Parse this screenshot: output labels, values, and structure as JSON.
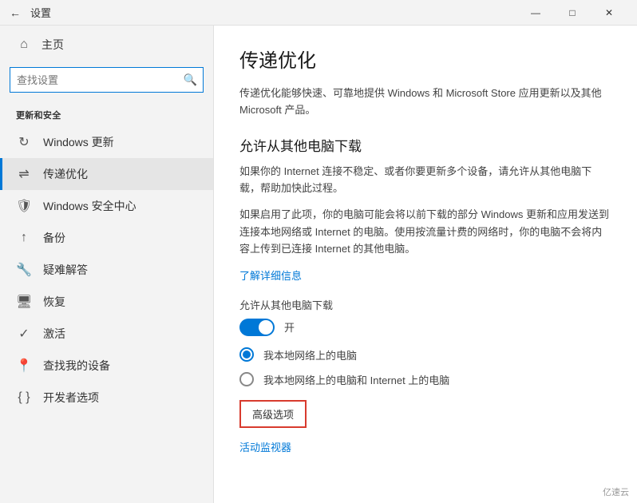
{
  "titlebar": {
    "back_icon": "←",
    "title": "设置",
    "minimize": "—",
    "maximize": "□",
    "close": "✕"
  },
  "sidebar": {
    "home_label": "主页",
    "search_placeholder": "查找设置",
    "section_title": "更新和安全",
    "items": [
      {
        "id": "windows-update",
        "label": "Windows 更新",
        "icon": "↻"
      },
      {
        "id": "delivery-opt",
        "label": "传递优化",
        "icon": "⇌",
        "active": true
      },
      {
        "id": "windows-security",
        "label": "Windows 安全中心",
        "icon": "🛡"
      },
      {
        "id": "backup",
        "label": "备份",
        "icon": "↑"
      },
      {
        "id": "troubleshoot",
        "label": "疑难解答",
        "icon": "🔑"
      },
      {
        "id": "recovery",
        "label": "恢复",
        "icon": "⊕"
      },
      {
        "id": "activation",
        "label": "激活",
        "icon": "✓"
      },
      {
        "id": "find-device",
        "label": "查找我的设备",
        "icon": "⊕"
      },
      {
        "id": "developer",
        "label": "开发者选项",
        "icon": "⊕"
      }
    ]
  },
  "content": {
    "title": "传递优化",
    "description": "传递优化能够快速、可靠地提供 Windows 和 Microsoft Store 应用更新以及其他 Microsoft 产品。",
    "allow_heading": "允许从其他电脑下载",
    "allow_desc1": "如果你的 Internet 连接不稳定、或者你要更新多个设备，请允许从其他电脑下载，帮助加快此过程。",
    "allow_desc2": "如果启用了此项，你的电脑可能会将以前下载的部分 Windows 更新和应用发送到连接本地网络或 Internet 的电脑。使用按流量计费的网络时，你的电脑不会将内容上传到已连接 Internet 的其他电脑。",
    "learn_more": "了解详细信息",
    "toggle_label": "允许从其他电脑下载",
    "toggle_state": "开",
    "radio1_label": "我本地网络上的电脑",
    "radio2_label": "我本地网络上的电脑和 Internet 上的电脑",
    "advanced_btn": "高级选项",
    "monitor_link": "活动监视器"
  },
  "watermark": {
    "text": "亿速云"
  }
}
